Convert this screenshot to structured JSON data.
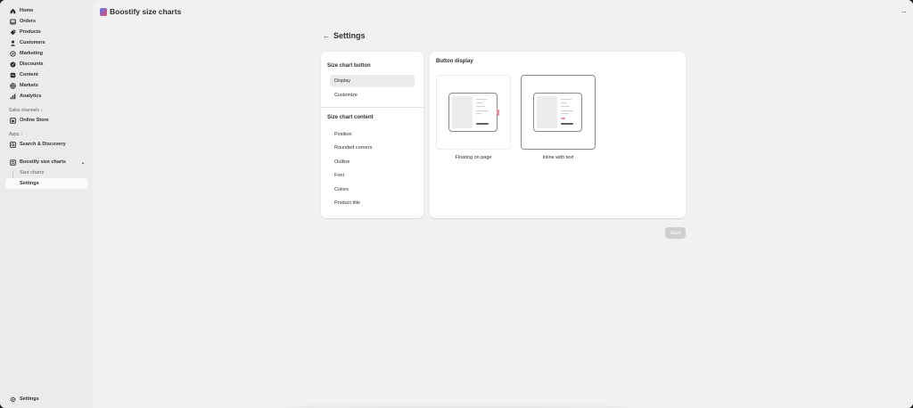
{
  "sidebar": {
    "items": [
      {
        "label": "Home",
        "icon": "home-icon"
      },
      {
        "label": "Orders",
        "icon": "inbox-icon"
      },
      {
        "label": "Products",
        "icon": "tag-icon"
      },
      {
        "label": "Customers",
        "icon": "person-icon"
      },
      {
        "label": "Marketing",
        "icon": "target-icon"
      },
      {
        "label": "Discounts",
        "icon": "discount-icon"
      },
      {
        "label": "Content",
        "icon": "content-icon"
      },
      {
        "label": "Markets",
        "icon": "globe-icon"
      },
      {
        "label": "Analytics",
        "icon": "bar-chart-icon"
      }
    ],
    "sales_channels_label": "Sales channels",
    "online_store": "Online Store",
    "apps_label": "Apps",
    "search_discovery": "Search & Discovery",
    "app_name": "Boostify size charts",
    "app_subitems": [
      "Size charts",
      "Settings"
    ],
    "bottom_settings": "Settings"
  },
  "topbar": {
    "app_title": "Boostify size charts",
    "more": "···"
  },
  "page": {
    "title": "Settings",
    "save_label": "Save"
  },
  "menu": {
    "section1_title": "Size chart button",
    "section1_items": [
      "Display",
      "Customize"
    ],
    "section2_title": "Size chart content",
    "section2_items": [
      "Position",
      "Rounded corners",
      "Outline",
      "Font",
      "Colors",
      "Product title"
    ]
  },
  "display": {
    "title": "Button display",
    "options": [
      "Floating on page",
      "Inline with text"
    ],
    "selected": "Inline with text"
  },
  "colors": {
    "accent_pink": "#e48ea0",
    "save_disabled": "#cfcfcf"
  }
}
